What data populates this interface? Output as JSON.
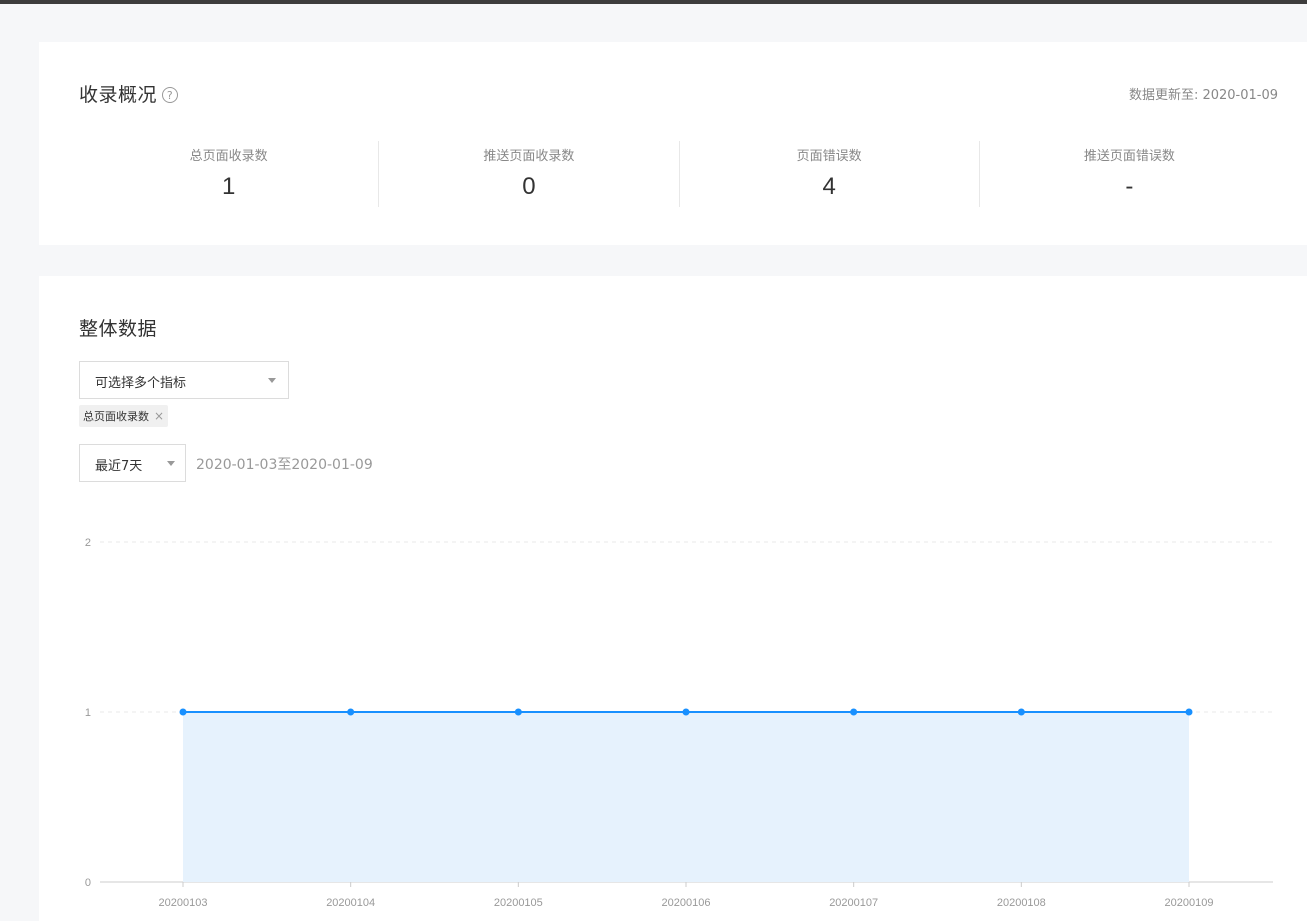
{
  "overview": {
    "title": "收录概况",
    "help_icon": "?",
    "update_text": "数据更新至: 2020-01-09",
    "stats": [
      {
        "label": "总页面收录数",
        "value": "1"
      },
      {
        "label": "推送页面收录数",
        "value": "0"
      },
      {
        "label": "页面错误数",
        "value": "4"
      },
      {
        "label": "推送页面错误数",
        "value": "-"
      }
    ]
  },
  "overall": {
    "title": "整体数据",
    "metric_select_placeholder": "可选择多个指标",
    "selected_tags": [
      "总页面收录数"
    ],
    "tag_close": "×",
    "range_select_value": "最近7天",
    "range_text": "2020-01-03至2020-01-09"
  },
  "chart_data": {
    "type": "area",
    "x": [
      "20200103",
      "20200104",
      "20200105",
      "20200106",
      "20200107",
      "20200108",
      "20200109"
    ],
    "series": [
      {
        "values": [
          1,
          1,
          1,
          1,
          1,
          1,
          1
        ],
        "color": "#1890ff",
        "fill": "#e6f2fd"
      }
    ],
    "yticks": [
      "0",
      "1",
      "2"
    ],
    "ylim": [
      0,
      2
    ],
    "grid": true
  }
}
